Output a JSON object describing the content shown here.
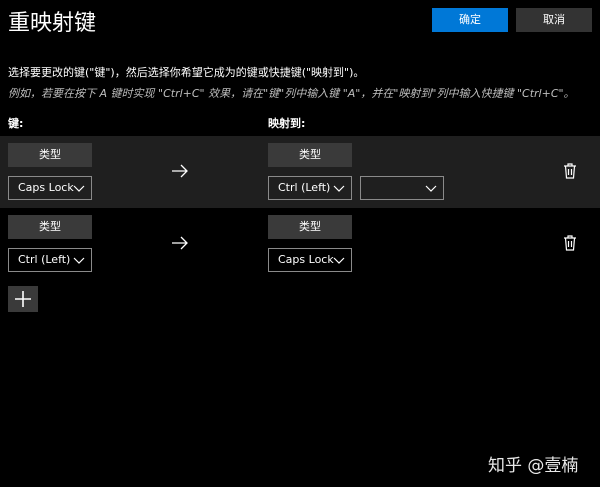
{
  "window": {
    "title": "重映射键",
    "ok_label": "确定",
    "cancel_label": "取消"
  },
  "instructions": {
    "line1": "选择要更改的键(\"键\")，然后选择你希望它成为的键或快捷键(\"映射到\")。",
    "line2": "例如，若要在按下 A 键时实现 \"Ctrl+C\" 效果，请在\"键\"列中输入键 \"A\"，并在\"映射到\"列中输入快捷键 \"Ctrl+C\"。"
  },
  "columns": {
    "key_label": "键:",
    "map_label": "映射到:"
  },
  "rows": [
    {
      "key_type_label": "类型",
      "key_value": "Caps Lock",
      "map_type_label": "类型",
      "map_value": "Ctrl (Left)",
      "map_extra_value": ""
    },
    {
      "key_type_label": "类型",
      "key_value": "Ctrl (Left)",
      "map_type_label": "类型",
      "map_value": "Caps Lock"
    }
  ],
  "watermark": "知乎 @壹楠",
  "colors": {
    "accent": "#0078d7",
    "row_highlight": "#1f1f1f",
    "button_bg": "#3a3a3a"
  }
}
